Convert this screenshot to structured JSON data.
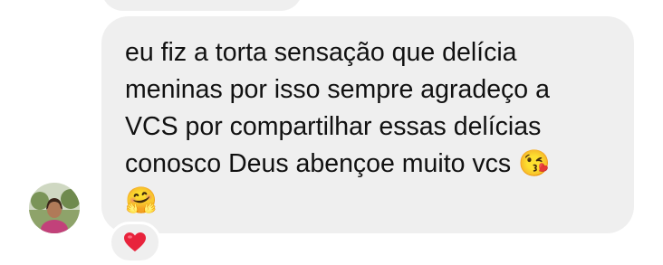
{
  "message": {
    "text": "eu fiz a torta sensação que delícia\nmeninas por isso sempre agradeço a\nVCS por compartilhar essas delícias\nconosco Deus abençoe muito vcs 😘\n🤗"
  },
  "reaction": {
    "icon": "heart-icon",
    "color": "#e8233c"
  },
  "colors": {
    "bubble": "#efefef",
    "text": "#111111"
  }
}
